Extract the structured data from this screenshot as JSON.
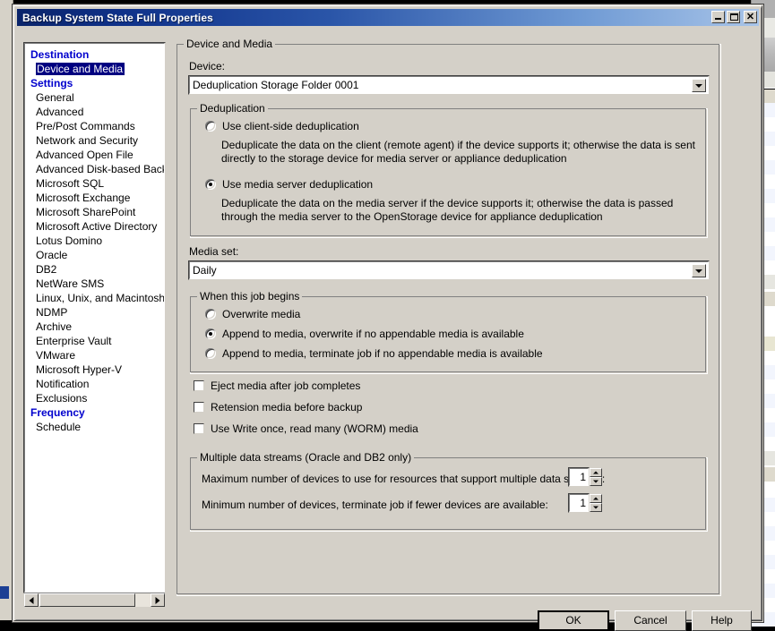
{
  "window": {
    "title": "Backup System State Full Properties",
    "buttons": {
      "minimize": "_",
      "maximize": "□",
      "close": "×"
    }
  },
  "sidebar": {
    "items": [
      {
        "label": "Destination",
        "type": "header",
        "selected": false
      },
      {
        "label": "Device and Media",
        "type": "item",
        "selected": true
      },
      {
        "label": "Settings",
        "type": "header",
        "selected": false
      },
      {
        "label": "General",
        "type": "item",
        "selected": false
      },
      {
        "label": "Advanced",
        "type": "item",
        "selected": false
      },
      {
        "label": "Pre/Post Commands",
        "type": "item",
        "selected": false
      },
      {
        "label": "Network and Security",
        "type": "item",
        "selected": false
      },
      {
        "label": "Advanced Open File",
        "type": "item",
        "selected": false
      },
      {
        "label": "Advanced Disk-based Backup",
        "type": "item",
        "selected": false
      },
      {
        "label": "Microsoft SQL",
        "type": "item",
        "selected": false
      },
      {
        "label": "Microsoft Exchange",
        "type": "item",
        "selected": false
      },
      {
        "label": "Microsoft SharePoint",
        "type": "item",
        "selected": false
      },
      {
        "label": "Microsoft Active Directory",
        "type": "item",
        "selected": false
      },
      {
        "label": "Lotus Domino",
        "type": "item",
        "selected": false
      },
      {
        "label": "Oracle",
        "type": "item",
        "selected": false
      },
      {
        "label": "DB2",
        "type": "item",
        "selected": false
      },
      {
        "label": "NetWare SMS",
        "type": "item",
        "selected": false
      },
      {
        "label": "Linux, Unix, and Macintosh",
        "type": "item",
        "selected": false
      },
      {
        "label": "NDMP",
        "type": "item",
        "selected": false
      },
      {
        "label": "Archive",
        "type": "item",
        "selected": false
      },
      {
        "label": "Enterprise Vault",
        "type": "item",
        "selected": false
      },
      {
        "label": "VMware",
        "type": "item",
        "selected": false
      },
      {
        "label": "Microsoft Hyper-V",
        "type": "item",
        "selected": false
      },
      {
        "label": "Notification",
        "type": "item",
        "selected": false
      },
      {
        "label": "Exclusions",
        "type": "item",
        "selected": false
      },
      {
        "label": "Frequency",
        "type": "header",
        "selected": false
      },
      {
        "label": "Schedule",
        "type": "item",
        "selected": false
      }
    ]
  },
  "main": {
    "group_title": "Device and Media",
    "device": {
      "label": "Device:",
      "value": "Deduplication Storage Folder 0001"
    },
    "deduplication": {
      "group_title": "Deduplication",
      "options": [
        {
          "label": "Use client-side deduplication",
          "selected": false,
          "description": "Deduplicate the data on the client (remote agent) if the device supports it; otherwise the data is sent directly to the storage device for media server or appliance deduplication"
        },
        {
          "label": "Use media server deduplication",
          "selected": true,
          "description": "Deduplicate the data on the media server if the device supports it; otherwise the data is passed through the media server to the OpenStorage device for appliance deduplication"
        }
      ]
    },
    "media_set": {
      "label": "Media set:",
      "value": "Daily"
    },
    "when_job_begins": {
      "group_title": "When this job begins",
      "options": [
        {
          "label": "Overwrite media",
          "selected": false
        },
        {
          "label": "Append to media, overwrite if no appendable media is available",
          "selected": true
        },
        {
          "label": "Append to media, terminate job if no appendable media is available",
          "selected": false
        }
      ]
    },
    "checkboxes": [
      {
        "label": "Eject media after job completes",
        "checked": false
      },
      {
        "label": "Retension media before backup",
        "checked": false
      },
      {
        "label": "Use Write once, read many (WORM) media",
        "checked": false
      }
    ],
    "multiple_data_streams": {
      "group_title": "Multiple data streams (Oracle and DB2 only)",
      "rows": [
        {
          "label": "Maximum number of devices to use for resources that support multiple data streams:",
          "value": "1"
        },
        {
          "label": "Minimum number of devices, terminate job if fewer devices are available:",
          "value": "1"
        }
      ]
    }
  },
  "footer": {
    "ok": "OK",
    "cancel": "Cancel",
    "help": "Help"
  },
  "colors": {
    "dialog_face": "#d4d0c8",
    "title_gradient_start": "#0a246a",
    "title_gradient_end": "#a8c4e8",
    "header_text": "#0000cd",
    "selection": "#000080"
  }
}
